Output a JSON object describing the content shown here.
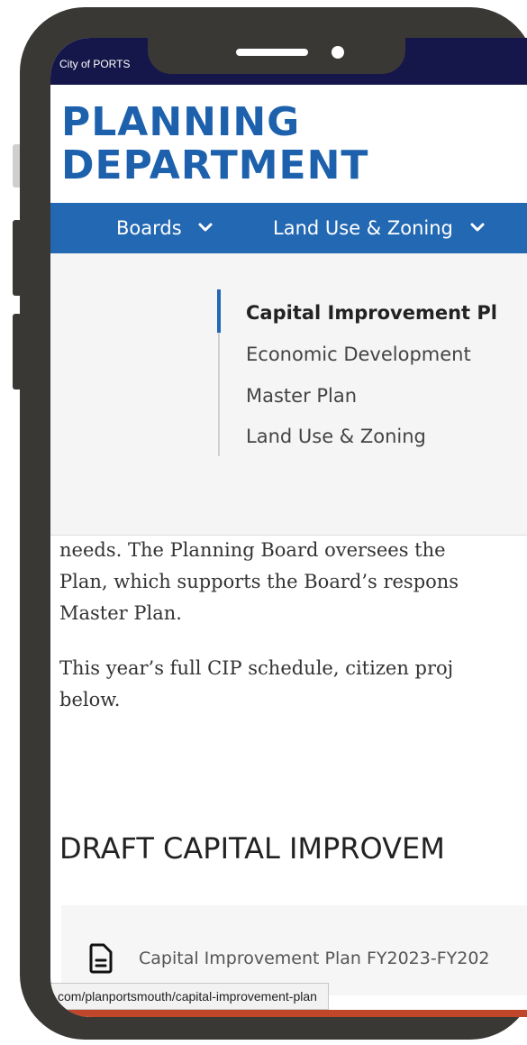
{
  "topbar": {
    "city": "City of PORTS"
  },
  "brand": {
    "line1": "PLANNING",
    "line2": "DEPARTMENT"
  },
  "nav": {
    "items": [
      {
        "label": "Boards",
        "chevron": "chevron-down-icon"
      },
      {
        "label": "Land Use & Zoning",
        "chevron": "chevron-down-icon"
      }
    ]
  },
  "submenu": {
    "links": [
      {
        "label": "Capital Improvement Pl",
        "active": true
      },
      {
        "label": "Economic Development",
        "active": false
      },
      {
        "label": "Master Plan",
        "active": false
      },
      {
        "label": "Land Use & Zoning",
        "active": false
      }
    ]
  },
  "body": {
    "lines": [
      "needs. The Planning Board oversees the",
      "Plan, which supports the Board’s respons",
      "Master Plan.",
      "This year’s full CIP schedule, citizen proj",
      "below."
    ]
  },
  "section": {
    "title": "DRAFT CAPITAL IMPROVEM"
  },
  "documents": [
    {
      "icon": "document-icon",
      "label": "Capital Improvement Plan FY2023-FY202"
    }
  ],
  "status_url": "com/planportsmouth/capital-improvement-plan",
  "colors": {
    "topbar": "#15174a",
    "brand_blue": "#1d61ad",
    "nav_blue": "#2368b3",
    "accent_band": "#c0462a",
    "phone_frame": "#3a3835"
  }
}
